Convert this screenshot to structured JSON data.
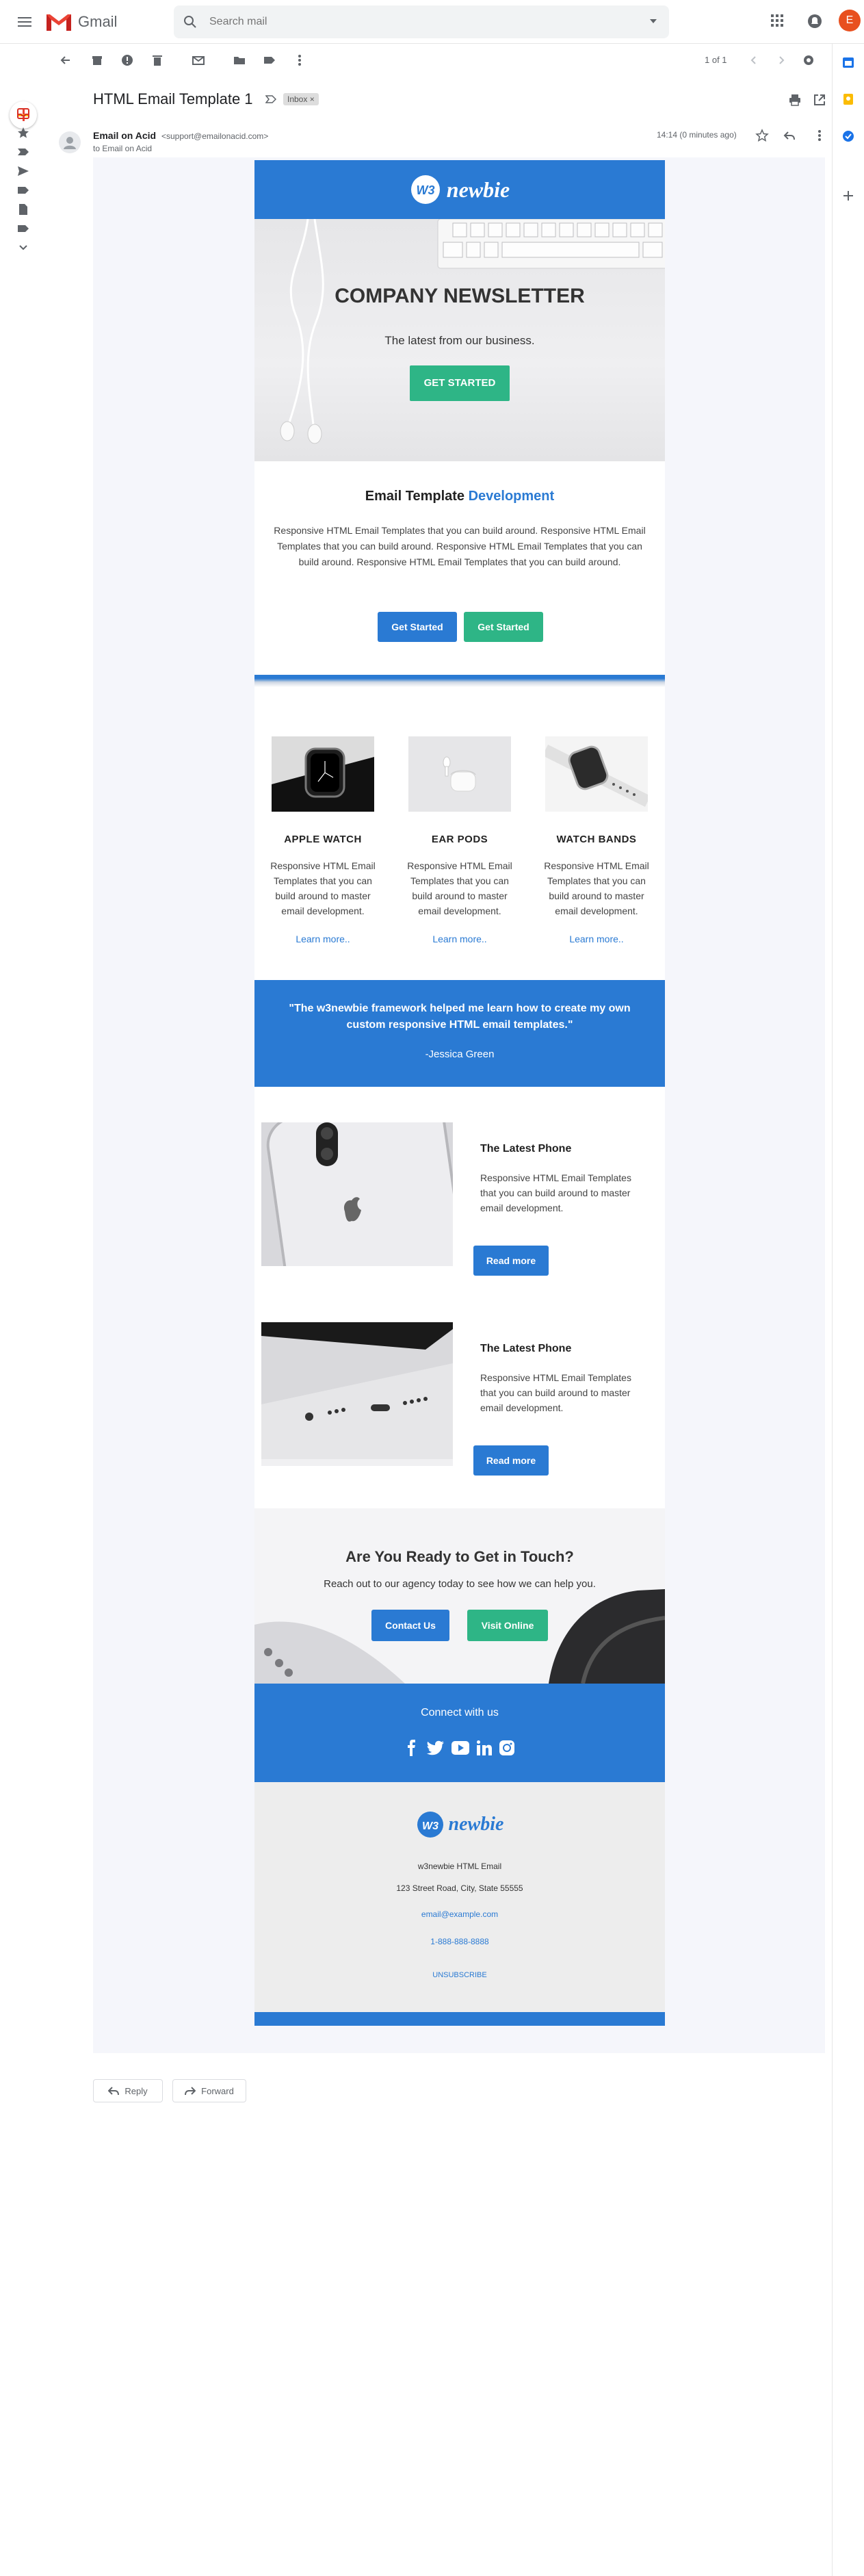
{
  "gmail": {
    "app_name": "Gmail",
    "search_placeholder": "Search mail",
    "avatar_initial": "E",
    "pager": "1 of 1"
  },
  "message": {
    "subject": "HTML Email Template 1",
    "label": "Inbox ×",
    "sender_name": "Email on Acid",
    "sender_email": "<support@emailonacid.com>",
    "recipient": "to Email on Acid",
    "timestamp": "14:14 (0 minutes ago)"
  },
  "email": {
    "brand": "newbie",
    "brand_mark": "W3",
    "hero": {
      "title": "COMPANY NEWSLETTER",
      "subtitle": "The latest from our business.",
      "button": "GET STARTED"
    },
    "intro": {
      "title_prefix": "Email Template ",
      "title_accent": "Development",
      "text": "Responsive HTML Email Templates that you can build around. Responsive HTML Email Templates that you can build around. Responsive HTML Email Templates that you can build around. Responsive HTML Email Templates that you can build around.",
      "button_primary": "Get Started",
      "button_secondary": "Get Started"
    },
    "products": [
      {
        "name": "APPLE WATCH",
        "text": "Responsive HTML Email Templates that you can build around to master email development.",
        "link": "Learn more.."
      },
      {
        "name": "EAR PODS",
        "text": "Responsive HTML Email Templates that you can build around to master email development.",
        "link": "Learn more.."
      },
      {
        "name": "WATCH BANDS",
        "text": "Responsive HTML Email Templates that you can build around to master email development.",
        "link": "Learn more.."
      }
    ],
    "quote": {
      "text": "\"The w3newbie framework helped me learn how to create my own custom responsive HTML email templates.\"",
      "author": "-Jessica Green"
    },
    "features": [
      {
        "title": "The Latest Phone",
        "text": "Responsive HTML Email Templates that you can build around to master email development.",
        "button": "Read more"
      },
      {
        "title": "The Latest Phone",
        "text": "Responsive HTML Email Templates that you can build around to master email development.",
        "button": "Read more"
      }
    ],
    "cta": {
      "title": "Are You Ready to Get in Touch?",
      "subtitle": "Reach out to our agency today to see how we can help you.",
      "button_primary": "Contact Us",
      "button_secondary": "Visit Online"
    },
    "social": {
      "title": "Connect with us",
      "icons": [
        "facebook-icon",
        "twitter-icon",
        "youtube-icon",
        "linkedin-icon",
        "instagram-icon"
      ]
    },
    "footer": {
      "company": "w3newbie HTML Email",
      "address": "123 Street Road, City, State 55555",
      "email": "email@example.com",
      "phone": "1-888-888-8888",
      "unsubscribe": "UNSUBSCRIBE"
    }
  },
  "actions": {
    "reply": "Reply",
    "forward": "Forward"
  },
  "colors": {
    "brand_blue": "#2a7ad3",
    "brand_green": "#2eb586",
    "gmail_red": "#ea4335",
    "avatar": "#e8501f"
  }
}
